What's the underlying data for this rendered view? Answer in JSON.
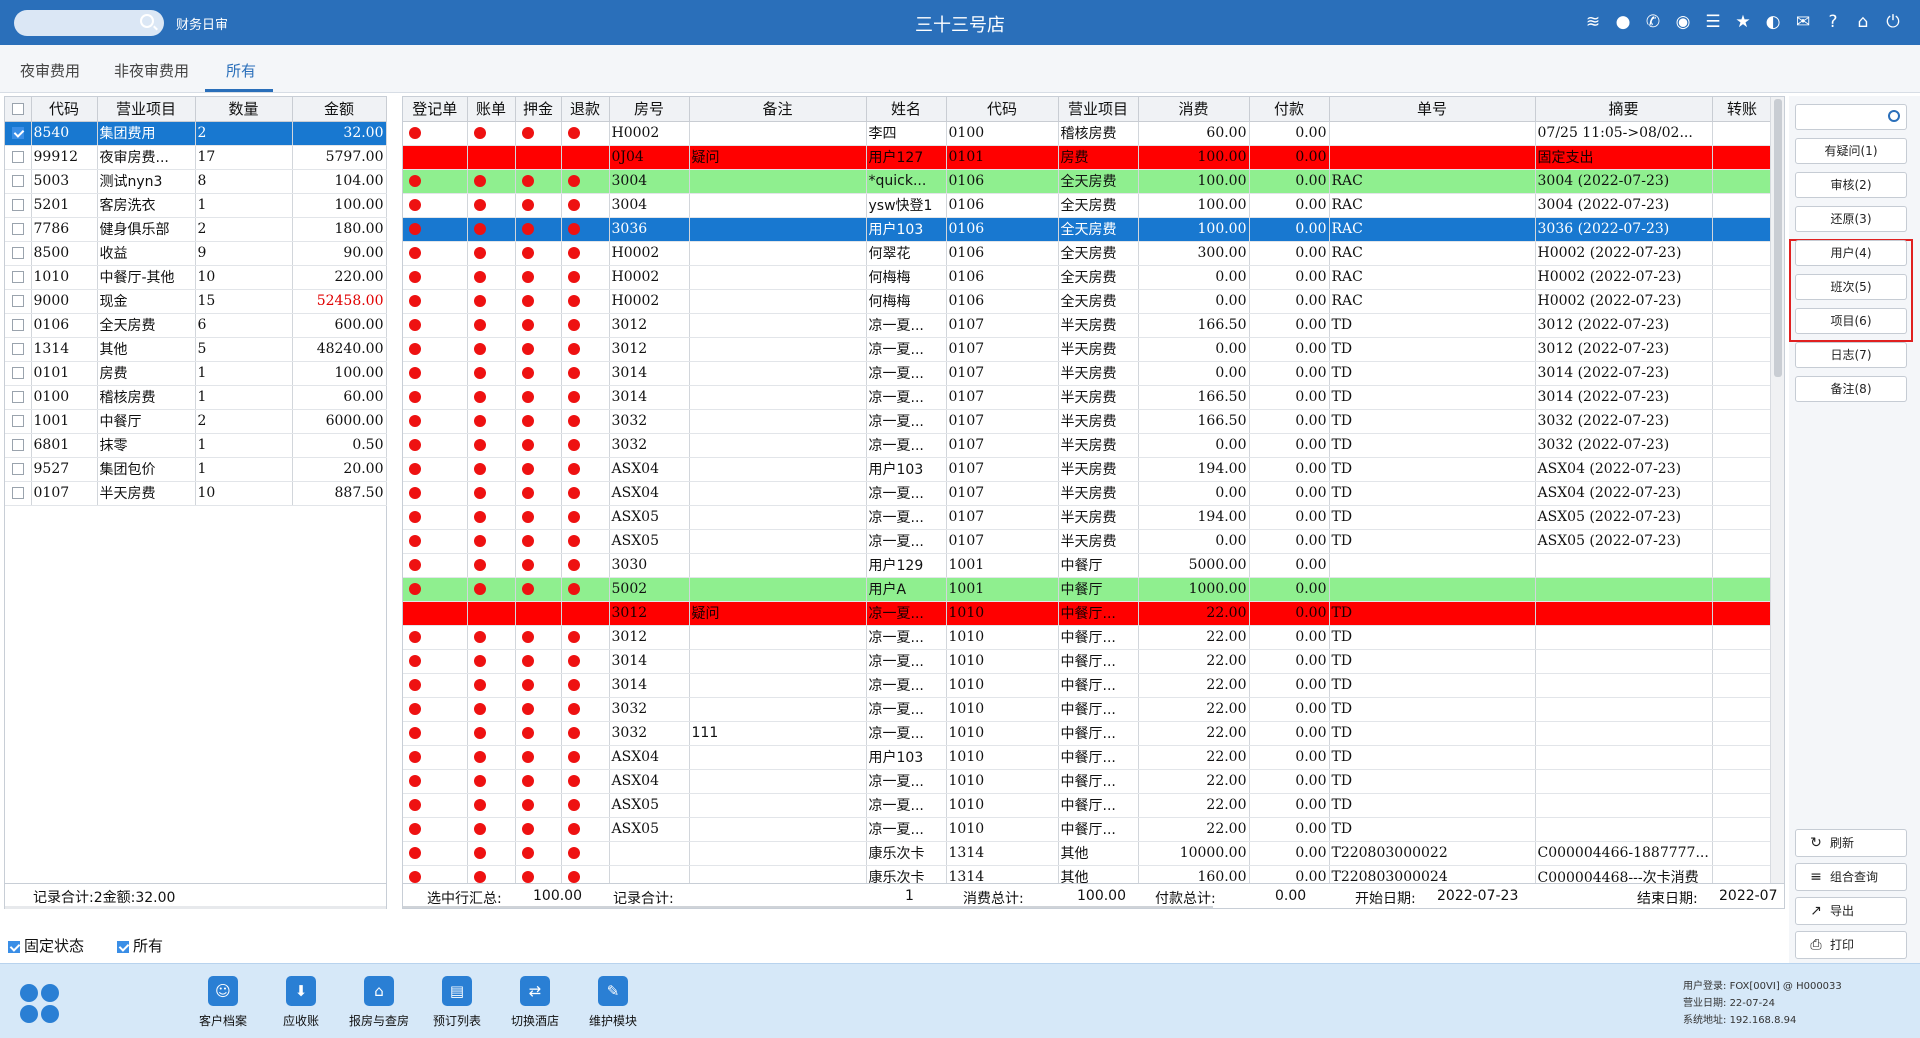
{
  "titlebar": {
    "module": "财务日审",
    "title": "三十三号店",
    "icons": [
      "wifi-icon",
      "chat-icon",
      "phone-icon",
      "palette-icon",
      "menu-icon",
      "star-icon",
      "theme-icon",
      "mail-icon",
      "help-icon",
      "home-icon",
      "power-icon"
    ]
  },
  "tabs": [
    "夜审费用",
    "非夜审费用",
    "所有"
  ],
  "left": {
    "headers": [
      "代码",
      "营业项目",
      "数量",
      "金额"
    ],
    "rows": [
      {
        "checked": true,
        "code": "8540",
        "item": "集团费用",
        "qty": "2",
        "amount": "32.00",
        "sel": true
      },
      {
        "checked": false,
        "code": "99912",
        "item": "夜审房费...",
        "qty": "17",
        "amount": "5797.00"
      },
      {
        "checked": false,
        "code": "5003",
        "item": "测试nyn3",
        "qty": "8",
        "amount": "104.00"
      },
      {
        "checked": false,
        "code": "5201",
        "item": "客房洗衣",
        "qty": "1",
        "amount": "100.00"
      },
      {
        "checked": false,
        "code": "7786",
        "item": "健身俱乐部",
        "qty": "2",
        "amount": "180.00"
      },
      {
        "checked": false,
        "code": "8500",
        "item": "收益",
        "qty": "9",
        "amount": "90.00"
      },
      {
        "checked": false,
        "code": "1010",
        "item": "中餐厅-其他",
        "qty": "10",
        "amount": "220.00"
      },
      {
        "checked": false,
        "code": "9000",
        "item": "现金",
        "qty": "15",
        "amount": "52458.00",
        "red": true
      },
      {
        "checked": false,
        "code": "0106",
        "item": "全天房费",
        "qty": "6",
        "amount": "600.00"
      },
      {
        "checked": false,
        "code": "1314",
        "item": "其他",
        "qty": "5",
        "amount": "48240.00"
      },
      {
        "checked": false,
        "code": "0101",
        "item": "房费",
        "qty": "1",
        "amount": "100.00"
      },
      {
        "checked": false,
        "code": "0100",
        "item": "稽核房费",
        "qty": "1",
        "amount": "60.00"
      },
      {
        "checked": false,
        "code": "1001",
        "item": "中餐厅",
        "qty": "2",
        "amount": "6000.00"
      },
      {
        "checked": false,
        "code": "6801",
        "item": "抹零",
        "qty": "1",
        "amount": "0.50"
      },
      {
        "checked": false,
        "code": "9527",
        "item": "集团包价",
        "qty": "1",
        "amount": "20.00"
      },
      {
        "checked": false,
        "code": "0107",
        "item": "半天房费",
        "qty": "10",
        "amount": "887.50"
      }
    ],
    "summary": "记录合计:2金额:32.00"
  },
  "main": {
    "headers": [
      "登记单",
      "账单",
      "押金",
      "退款",
      "房号",
      "备注",
      "姓名",
      "代码",
      "营业项目",
      "消费",
      "付款",
      "单号",
      "摘要",
      "转账"
    ],
    "rows": [
      {
        "style": "",
        "dots": true,
        "room": "H0002",
        "note": "",
        "name": "李四",
        "code": "0100",
        "item": "稽核房费",
        "consume": "60.00",
        "pay": "0.00",
        "no": "",
        "summary": "07/25 11:05->08/02..."
      },
      {
        "style": "red",
        "dots": false,
        "room": "0J04",
        "note": "疑问",
        "name": "用户127",
        "code": "0101",
        "item": "房费",
        "consume": "100.00",
        "pay": "0.00",
        "no": "",
        "summary": "固定支出"
      },
      {
        "style": "green",
        "dots": true,
        "room": "3004",
        "note": "",
        "name": "*quick...",
        "code": "0106",
        "item": "全天房费",
        "consume": "100.00",
        "pay": "0.00",
        "no": "RAC",
        "summary": "3004 (2022-07-23)"
      },
      {
        "style": "",
        "dots": true,
        "room": "3004",
        "note": "",
        "name": "ysw快登1",
        "code": "0106",
        "item": "全天房费",
        "consume": "100.00",
        "pay": "0.00",
        "no": "RAC",
        "summary": "3004 (2022-07-23)"
      },
      {
        "style": "sel",
        "dots": true,
        "room": "3036",
        "note": "",
        "name": "用户103",
        "code": "0106",
        "item": "全天房费",
        "consume": "100.00",
        "pay": "0.00",
        "no": "RAC",
        "summary": "3036 (2022-07-23)"
      },
      {
        "style": "",
        "dots": true,
        "room": "H0002",
        "note": "",
        "name": "何翠花",
        "code": "0106",
        "item": "全天房费",
        "consume": "300.00",
        "pay": "0.00",
        "no": "RAC",
        "summary": "H0002 (2022-07-23)"
      },
      {
        "style": "",
        "dots": true,
        "room": "H0002",
        "note": "",
        "name": "何梅梅",
        "code": "0106",
        "item": "全天房费",
        "consume": "0.00",
        "pay": "0.00",
        "no": "RAC",
        "summary": "H0002 (2022-07-23)"
      },
      {
        "style": "",
        "dots": true,
        "room": "H0002",
        "note": "",
        "name": "何梅梅",
        "code": "0106",
        "item": "全天房费",
        "consume": "0.00",
        "pay": "0.00",
        "no": "RAC",
        "summary": "H0002 (2022-07-23)"
      },
      {
        "style": "",
        "dots": true,
        "room": "3012",
        "note": "",
        "name": "凉一夏...",
        "code": "0107",
        "item": "半天房费",
        "consume": "166.50",
        "pay": "0.00",
        "no": "TD",
        "summary": "3012 (2022-07-23)"
      },
      {
        "style": "",
        "dots": true,
        "room": "3012",
        "note": "",
        "name": "凉一夏...",
        "code": "0107",
        "item": "半天房费",
        "consume": "0.00",
        "pay": "0.00",
        "no": "TD",
        "summary": "3012 (2022-07-23)"
      },
      {
        "style": "",
        "dots": true,
        "room": "3014",
        "note": "",
        "name": "凉一夏...",
        "code": "0107",
        "item": "半天房费",
        "consume": "0.00",
        "pay": "0.00",
        "no": "TD",
        "summary": "3014 (2022-07-23)"
      },
      {
        "style": "",
        "dots": true,
        "room": "3014",
        "note": "",
        "name": "凉一夏...",
        "code": "0107",
        "item": "半天房费",
        "consume": "166.50",
        "pay": "0.00",
        "no": "TD",
        "summary": "3014 (2022-07-23)"
      },
      {
        "style": "",
        "dots": true,
        "room": "3032",
        "note": "",
        "name": "凉一夏...",
        "code": "0107",
        "item": "半天房费",
        "consume": "166.50",
        "pay": "0.00",
        "no": "TD",
        "summary": "3032 (2022-07-23)"
      },
      {
        "style": "",
        "dots": true,
        "room": "3032",
        "note": "",
        "name": "凉一夏...",
        "code": "0107",
        "item": "半天房费",
        "consume": "0.00",
        "pay": "0.00",
        "no": "TD",
        "summary": "3032 (2022-07-23)"
      },
      {
        "style": "",
        "dots": true,
        "room": "ASX04",
        "note": "",
        "name": "用户103",
        "code": "0107",
        "item": "半天房费",
        "consume": "194.00",
        "pay": "0.00",
        "no": "TD",
        "summary": "ASX04 (2022-07-23)"
      },
      {
        "style": "",
        "dots": true,
        "room": "ASX04",
        "note": "",
        "name": "凉一夏...",
        "code": "0107",
        "item": "半天房费",
        "consume": "0.00",
        "pay": "0.00",
        "no": "TD",
        "summary": "ASX04 (2022-07-23)"
      },
      {
        "style": "",
        "dots": true,
        "room": "ASX05",
        "note": "",
        "name": "凉一夏...",
        "code": "0107",
        "item": "半天房费",
        "consume": "194.00",
        "pay": "0.00",
        "no": "TD",
        "summary": "ASX05 (2022-07-23)"
      },
      {
        "style": "",
        "dots": true,
        "room": "ASX05",
        "note": "",
        "name": "凉一夏...",
        "code": "0107",
        "item": "半天房费",
        "consume": "0.00",
        "pay": "0.00",
        "no": "TD",
        "summary": "ASX05 (2022-07-23)"
      },
      {
        "style": "",
        "dots": true,
        "room": "3030",
        "note": "",
        "name": "用户129",
        "code": "1001",
        "item": "中餐厅",
        "consume": "5000.00",
        "pay": "0.00",
        "no": "",
        "summary": ""
      },
      {
        "style": "green",
        "dots": true,
        "room": "5002",
        "note": "",
        "name": "用户A",
        "code": "1001",
        "item": "中餐厅",
        "consume": "1000.00",
        "pay": "0.00",
        "no": "",
        "summary": ""
      },
      {
        "style": "red",
        "dots": false,
        "room": "3012",
        "note": "疑问",
        "name": "凉一夏...",
        "code": "1010",
        "item": "中餐厅...",
        "consume": "22.00",
        "pay": "0.00",
        "no": "TD",
        "summary": ""
      },
      {
        "style": "",
        "dots": true,
        "room": "3012",
        "note": "",
        "name": "凉一夏...",
        "code": "1010",
        "item": "中餐厅...",
        "consume": "22.00",
        "pay": "0.00",
        "no": "TD",
        "summary": ""
      },
      {
        "style": "",
        "dots": true,
        "room": "3014",
        "note": "",
        "name": "凉一夏...",
        "code": "1010",
        "item": "中餐厅...",
        "consume": "22.00",
        "pay": "0.00",
        "no": "TD",
        "summary": ""
      },
      {
        "style": "",
        "dots": true,
        "room": "3014",
        "note": "",
        "name": "凉一夏...",
        "code": "1010",
        "item": "中餐厅...",
        "consume": "22.00",
        "pay": "0.00",
        "no": "TD",
        "summary": ""
      },
      {
        "style": "",
        "dots": true,
        "room": "3032",
        "note": "",
        "name": "凉一夏...",
        "code": "1010",
        "item": "中餐厅...",
        "consume": "22.00",
        "pay": "0.00",
        "no": "TD",
        "summary": ""
      },
      {
        "style": "",
        "dots": true,
        "room": "3032",
        "note": "111",
        "name": "凉一夏...",
        "code": "1010",
        "item": "中餐厅...",
        "consume": "22.00",
        "pay": "0.00",
        "no": "TD",
        "summary": ""
      },
      {
        "style": "",
        "dots": true,
        "room": "ASX04",
        "note": "",
        "name": "用户103",
        "code": "1010",
        "item": "中餐厅...",
        "consume": "22.00",
        "pay": "0.00",
        "no": "TD",
        "summary": ""
      },
      {
        "style": "",
        "dots": true,
        "room": "ASX04",
        "note": "",
        "name": "凉一夏...",
        "code": "1010",
        "item": "中餐厅...",
        "consume": "22.00",
        "pay": "0.00",
        "no": "TD",
        "summary": ""
      },
      {
        "style": "",
        "dots": true,
        "room": "ASX05",
        "note": "",
        "name": "凉一夏...",
        "code": "1010",
        "item": "中餐厅...",
        "consume": "22.00",
        "pay": "0.00",
        "no": "TD",
        "summary": ""
      },
      {
        "style": "",
        "dots": true,
        "room": "ASX05",
        "note": "",
        "name": "凉一夏...",
        "code": "1010",
        "item": "中餐厅...",
        "consume": "22.00",
        "pay": "0.00",
        "no": "TD",
        "summary": ""
      },
      {
        "style": "",
        "dots": true,
        "room": "",
        "note": "",
        "name": "康乐次卡",
        "code": "1314",
        "item": "其他",
        "consume": "10000.00",
        "pay": "0.00",
        "no": "T220803000022",
        "summary": "C000004466-1887777..."
      },
      {
        "style": "",
        "dots": true,
        "room": "",
        "note": "",
        "name": "康乐次卡",
        "code": "1314",
        "item": "其他",
        "consume": "160.00",
        "pay": "0.00",
        "no": "T220803000024",
        "summary": "C000004468---次卡消费"
      }
    ],
    "summary": {
      "selected_label": "选中行汇总:",
      "selected_value": "100.00",
      "count_label": "记录合计:",
      "count_value": "1",
      "consume_label": "消费总计:",
      "consume_value": "100.00",
      "pay_label": "付款总计:",
      "pay_value": "0.00",
      "start_label": "开始日期:",
      "start_value": "2022-07-23",
      "end_label": "结束日期:",
      "end_value": "2022-07"
    }
  },
  "side": {
    "buttons": [
      "有疑问(1)",
      "审核(2)",
      "还原(3)",
      "用户(4)",
      "班次(5)",
      "项目(6)",
      "日志(7)",
      "备注(8)"
    ],
    "actions": [
      {
        "label": "刷新",
        "icon": "↻"
      },
      {
        "label": "组合查询",
        "icon": "≡"
      },
      {
        "label": "导出",
        "icon": "↗"
      },
      {
        "label": "打印",
        "icon": "⎙"
      }
    ]
  },
  "options": [
    {
      "label": "固定状态",
      "checked": true
    },
    {
      "label": "所有",
      "checked": true
    }
  ],
  "footer": {
    "buttons": [
      "客户档案",
      "应收账",
      "报房与查房",
      "预订列表",
      "切换酒店",
      "维护模块"
    ],
    "info": {
      "user_label": "用户登录:",
      "user_value": "FOX[00VI] @ H000033",
      "date_label": "营业日期:",
      "date_value": "22-07-24",
      "addr_label": "系统地址:",
      "addr_value": "192.168.8.94"
    }
  }
}
